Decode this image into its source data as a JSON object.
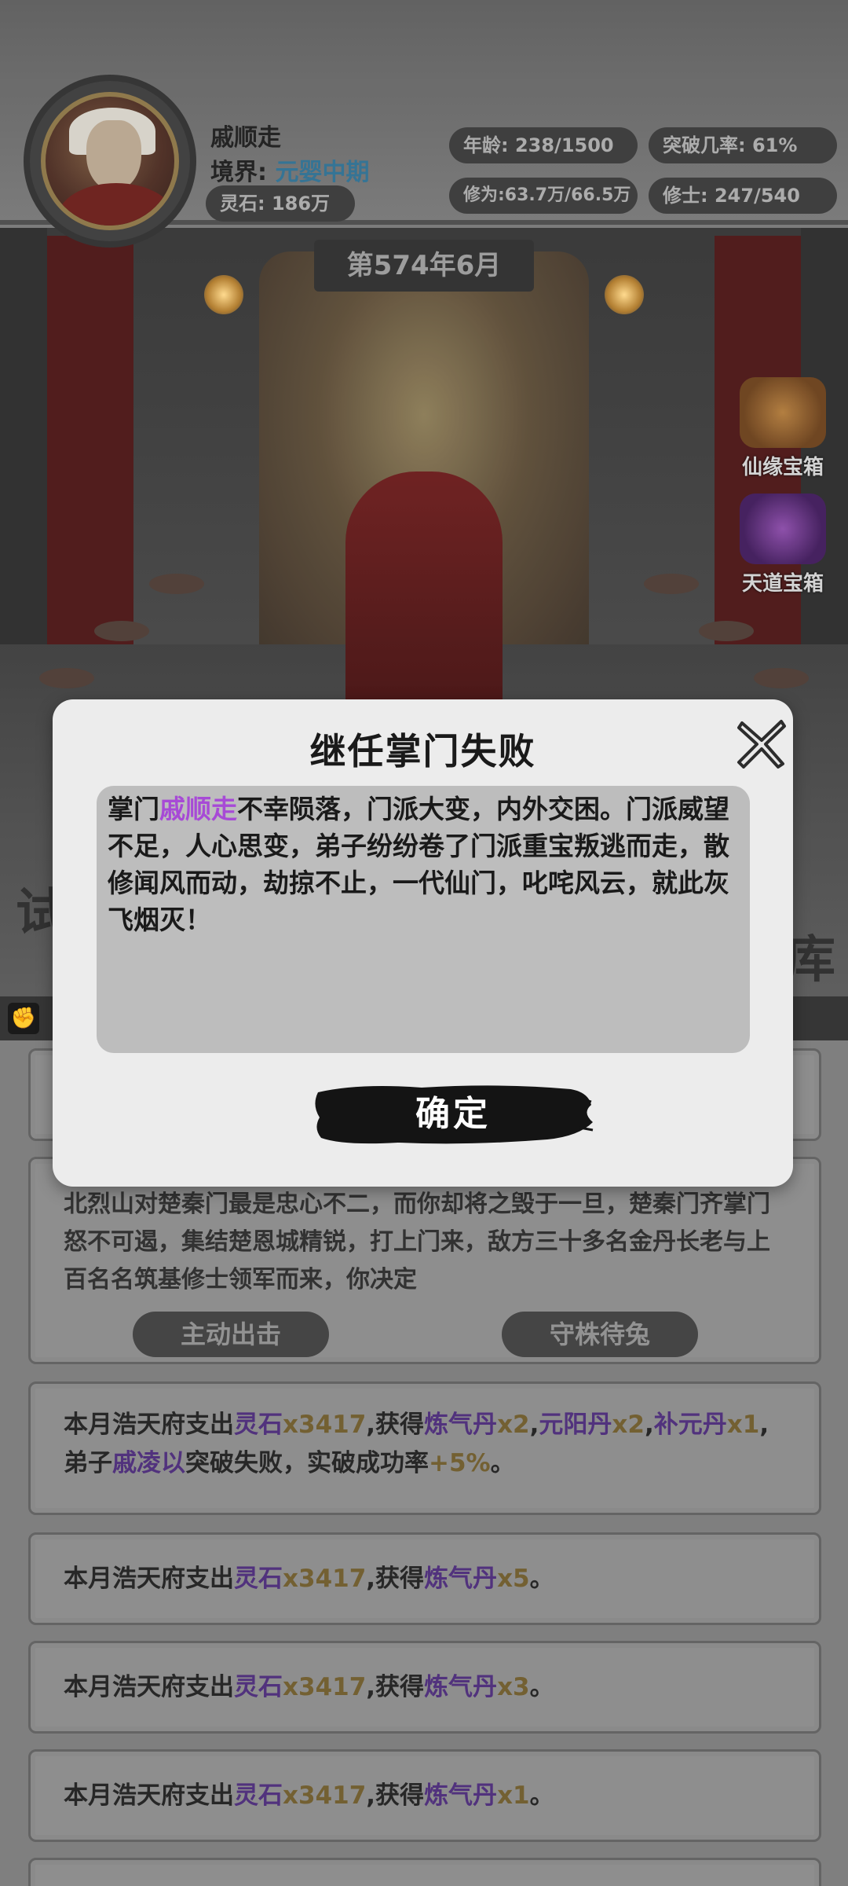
{
  "player": {
    "name": "戚顺走",
    "realm_label": "境界:",
    "realm_value": "元婴中期",
    "spirit_stone": "灵石: 186万",
    "age": "年龄: 238/1500",
    "breakthrough": "突破几率: 61%",
    "cultivation": "修为:63.7万/66.5万",
    "disciples": "修士: 247/540"
  },
  "date": "第574年6月",
  "chests": [
    {
      "label": "仙缘宝箱",
      "color": "#8a5a2a"
    },
    {
      "label": "天道宝箱",
      "color": "#5a2a7a"
    }
  ],
  "modal": {
    "title": "继任掌门失败",
    "msg_prefix": "掌门",
    "msg_name": "戚顺走",
    "msg_rest": "不幸陨落，门派大变，内外交困。门派威望不足，人心思变，弟子纷纷卷了门派重宝叛逃而走，散修闻风而动，劫掠不止，一代仙门，叱咤风云，就此灰飞烟灭！",
    "confirm_label": "确定"
  },
  "events": {
    "card2_text": "北烈山对楚秦门最是忠心不二，而你却将之毁于一旦，楚秦门齐掌门怒不可遏，集结楚恩城精锐，打上门来，敌方三十多名金丹长老与上百名名筑基修士领军而来，你决定",
    "btn_attack": "主动出击",
    "btn_defend": "守株待兔",
    "card3": {
      "a": "本月浩天府支出",
      "b": "灵石",
      "c": "x3417",
      "d": ",获得",
      "e": "炼气丹",
      "f": "x2",
      "g": ",",
      "h": "元阳丹",
      "i": "x2",
      "j": ",",
      "k": "补元丹",
      "l": "x1",
      "m": ",弟子",
      "n": "戚凌以",
      "o": "突破失败，实破成功率",
      "p": "+5%",
      "q": "。"
    },
    "card4": {
      "a": "本月浩天府支出",
      "b": "灵石",
      "c": "x3417",
      "d": ",获得",
      "e": "炼气丹",
      "f": "x5",
      "g": "。"
    },
    "card5": {
      "a": "本月浩天府支出",
      "b": "灵石",
      "c": "x3417",
      "d": ",获得",
      "e": "炼气丹",
      "f": "x3",
      "g": "。"
    },
    "card6": {
      "a": "本月浩天府支出",
      "b": "灵石",
      "c": "x3417",
      "d": ",获得",
      "e": "炼气丹",
      "f": "x1",
      "g": "。"
    }
  },
  "side_glyphs": {
    "left": "试",
    "right": "库"
  }
}
